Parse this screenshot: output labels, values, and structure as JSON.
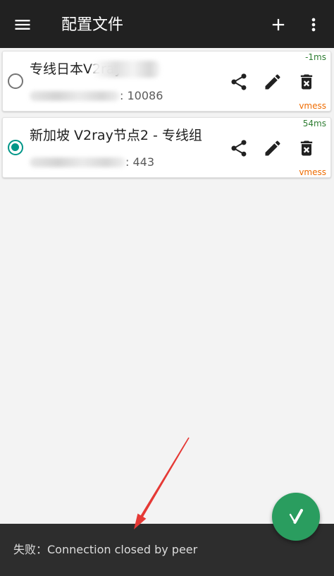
{
  "app_bar": {
    "title": "配置文件",
    "menu_icon": "menu-icon",
    "add_icon": "add-icon",
    "more_icon": "more-vert-icon"
  },
  "servers": [
    {
      "name": "专线日本V2ray",
      "address": ": 10086",
      "delay": "-1ms",
      "type": "vmess",
      "selected": false
    },
    {
      "name": "新加坡 V2ray节点2 - 专线组",
      "address": ": 443",
      "delay": "54ms",
      "type": "vmess",
      "selected": true
    }
  ],
  "row_actions": [
    "share-icon",
    "edit-icon",
    "delete-forever-icon"
  ],
  "fab": {
    "icon": "v2ray-logo-icon"
  },
  "snackbar": {
    "message": "失败：Connection closed by peer"
  },
  "colors": {
    "app_bar": "#212121",
    "background": "#f3f3f3",
    "text_primary": "#212121",
    "text_secondary": "#5a5a5a",
    "accent": "#009688",
    "radio_off": "#757575",
    "delay": "#2e7d32",
    "protocol": "#ef6c00",
    "fab": "#2a9d5f",
    "snackbar": "#2d2d2d",
    "snackbar_text": "#dcdcdc",
    "annotation": "#e53935"
  }
}
